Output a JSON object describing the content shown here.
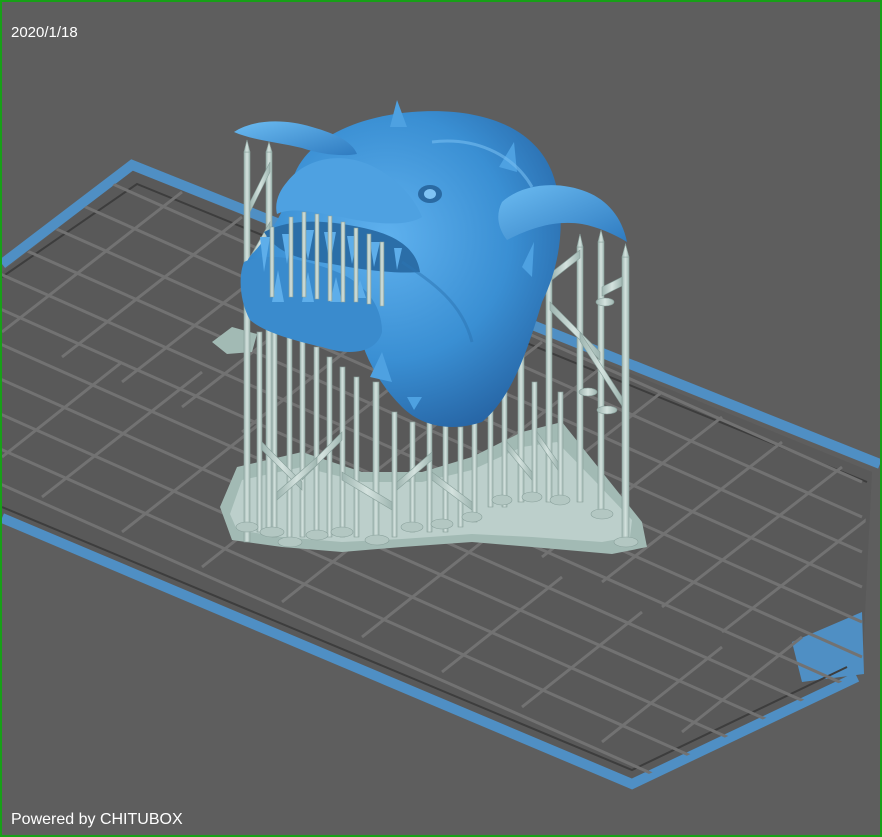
{
  "viewer": {
    "date": "2020/1/18",
    "powered_by": "Powered by CHITUBOX"
  },
  "colors": {
    "background": "#5e5e5e",
    "frame_border": "#18a018",
    "platform_outline": "#4f8fc4",
    "grid_line": "#707070",
    "model": "#3f93d6",
    "supports": "#b9ccc7",
    "raft": "#9fb8b2"
  },
  "scene": {
    "platform": "build-plate",
    "model": "demon-head",
    "supports": "support-structures"
  }
}
